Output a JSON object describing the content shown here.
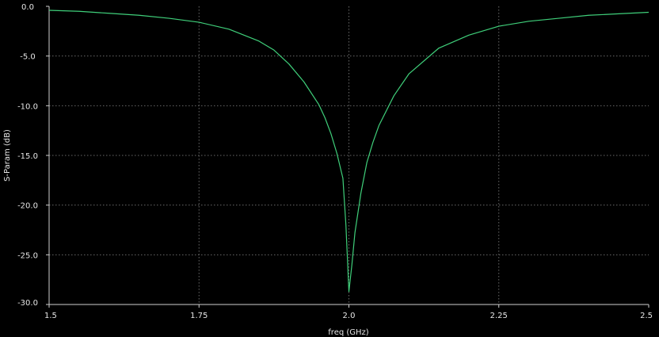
{
  "chart_data": {
    "type": "line",
    "title": "",
    "xlabel": "freq (GHz)",
    "ylabel": "S-Param (dB)",
    "xlim": [
      1.5,
      2.5
    ],
    "ylim": [
      -30.0,
      0.0
    ],
    "x_ticks": [
      1.5,
      1.75,
      2.0,
      2.25,
      2.5
    ],
    "x_tick_labels": [
      "1.5",
      "1.75",
      "2.0",
      "2.25",
      "2.5"
    ],
    "y_ticks": [
      0.0,
      -5.0,
      -10.0,
      -15.0,
      -20.0,
      -25.0,
      -30.0
    ],
    "y_tick_labels": [
      "0.0",
      "-5.0",
      "-10.0",
      "-15.0",
      "-20.0",
      "-25.0",
      "-30.0"
    ],
    "grid": true,
    "colors": {
      "background": "#000000",
      "axis": "#cfcfcf",
      "grid": "#6a6a6a",
      "series": "#3fcf7a",
      "text": "#e6e6e6"
    },
    "series": [
      {
        "values_x": [
          1.5,
          1.55,
          1.6,
          1.65,
          1.7,
          1.75,
          1.8,
          1.85,
          1.875,
          1.9,
          1.925,
          1.95,
          1.96,
          1.97,
          1.98,
          1.99,
          1.995,
          2.0,
          2.005,
          2.01,
          2.02,
          2.03,
          2.04,
          2.05,
          2.075,
          2.1,
          2.15,
          2.2,
          2.25,
          2.3,
          2.35,
          2.4,
          2.45,
          2.5
        ],
        "values_y": [
          -0.4,
          -0.5,
          -0.7,
          -0.9,
          -1.2,
          -1.6,
          -2.3,
          -3.5,
          -4.4,
          -5.8,
          -7.6,
          -9.9,
          -11.2,
          -12.8,
          -14.8,
          -17.3,
          -22.0,
          -28.7,
          -26.0,
          -22.8,
          -18.8,
          -15.7,
          -13.7,
          -12.0,
          -9.0,
          -6.8,
          -4.2,
          -2.9,
          -2.0,
          -1.5,
          -1.2,
          -0.9,
          -0.75,
          -0.6
        ]
      }
    ]
  }
}
